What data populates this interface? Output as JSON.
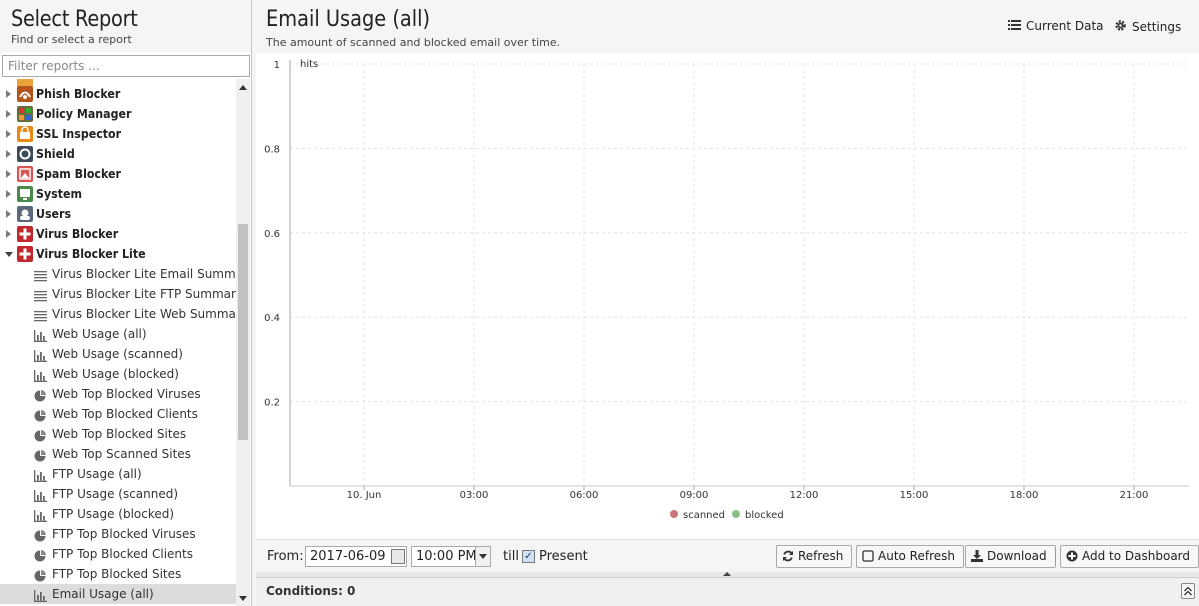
{
  "left": {
    "title": "Select Report",
    "subtitle": "Find or select a report",
    "filter_placeholder": "Filter reports ..."
  },
  "tree": [
    {
      "type": "cat",
      "label": "Phish Blocker",
      "icon": "phish-blocker-icon",
      "color": "#b5541b",
      "open": false
    },
    {
      "type": "cat",
      "label": "Policy Manager",
      "icon": "policy-manager-icon",
      "color": "#6b6b3a",
      "open": false
    },
    {
      "type": "cat",
      "label": "SSL Inspector",
      "icon": "ssl-inspector-icon",
      "color": "#e98a16",
      "open": false
    },
    {
      "type": "cat",
      "label": "Shield",
      "icon": "shield-icon",
      "color": "#3d4a5a",
      "open": false
    },
    {
      "type": "cat",
      "label": "Spam Blocker",
      "icon": "spam-blocker-icon",
      "color": "#d9534f",
      "open": false
    },
    {
      "type": "cat",
      "label": "System",
      "icon": "system-icon",
      "color": "#4a8a4a",
      "open": false
    },
    {
      "type": "cat",
      "label": "Users",
      "icon": "users-icon",
      "color": "#5a6a7a",
      "open": false
    },
    {
      "type": "cat",
      "label": "Virus Blocker",
      "icon": "virus-blocker-icon",
      "color": "#c0282d",
      "open": false
    },
    {
      "type": "cat",
      "label": "Virus Blocker Lite",
      "icon": "virus-blocker-lite-icon",
      "color": "#c0282d",
      "open": true
    },
    {
      "type": "item",
      "label": "Virus Blocker Lite Email Summary",
      "icon": "text-report-icon"
    },
    {
      "type": "item",
      "label": "Virus Blocker Lite FTP Summary",
      "icon": "text-report-icon"
    },
    {
      "type": "item",
      "label": "Virus Blocker Lite Web Summary",
      "icon": "text-report-icon"
    },
    {
      "type": "item",
      "label": "Web Usage (all)",
      "icon": "bar-chart-icon"
    },
    {
      "type": "item",
      "label": "Web Usage (scanned)",
      "icon": "bar-chart-icon"
    },
    {
      "type": "item",
      "label": "Web Usage (blocked)",
      "icon": "bar-chart-icon"
    },
    {
      "type": "item",
      "label": "Web Top Blocked Viruses",
      "icon": "pie-chart-icon"
    },
    {
      "type": "item",
      "label": "Web Top Blocked Clients",
      "icon": "pie-chart-icon"
    },
    {
      "type": "item",
      "label": "Web Top Blocked Sites",
      "icon": "pie-chart-icon"
    },
    {
      "type": "item",
      "label": "Web Top Scanned Sites",
      "icon": "pie-chart-icon"
    },
    {
      "type": "item",
      "label": "FTP Usage (all)",
      "icon": "bar-chart-icon"
    },
    {
      "type": "item",
      "label": "FTP Usage (scanned)",
      "icon": "bar-chart-icon"
    },
    {
      "type": "item",
      "label": "FTP Usage (blocked)",
      "icon": "bar-chart-icon"
    },
    {
      "type": "item",
      "label": "FTP Top Blocked Viruses",
      "icon": "pie-chart-icon"
    },
    {
      "type": "item",
      "label": "FTP Top Blocked Clients",
      "icon": "pie-chart-icon"
    },
    {
      "type": "item",
      "label": "FTP Top Blocked Sites",
      "icon": "pie-chart-icon"
    },
    {
      "type": "item",
      "label": "Email Usage (all)",
      "icon": "bar-chart-icon",
      "selected": true
    }
  ],
  "main": {
    "title": "Email Usage (all)",
    "subtitle": "The amount of scanned and blocked email over time.",
    "current_data_label": "Current Data",
    "settings_label": "Settings"
  },
  "chart_data": {
    "type": "line",
    "title": "",
    "ylabel": "hits",
    "ylim": [
      0,
      1
    ],
    "y_ticks": [
      "1",
      "0.8",
      "0.6",
      "0.4",
      "0.2"
    ],
    "x_ticks": [
      "10. Jun",
      "03:00",
      "06:00",
      "09:00",
      "12:00",
      "15:00",
      "18:00",
      "21:00"
    ],
    "series": [
      {
        "name": "scanned",
        "color": "#c9767a",
        "values": []
      },
      {
        "name": "blocked",
        "color": "#8cbf8c",
        "values": []
      }
    ],
    "grid": true,
    "legend": "bottom-center"
  },
  "toolbar": {
    "from_label": "From:",
    "date_value": "2017-06-09",
    "time_value": "10:00 PM",
    "till_label": "till",
    "present_label": "Present",
    "refresh_label": "Refresh",
    "auto_refresh_label": "Auto Refresh",
    "download_label": "Download",
    "add_dashboard_label": "Add to Dashboard"
  },
  "conditions": {
    "label": "Conditions: 0"
  }
}
